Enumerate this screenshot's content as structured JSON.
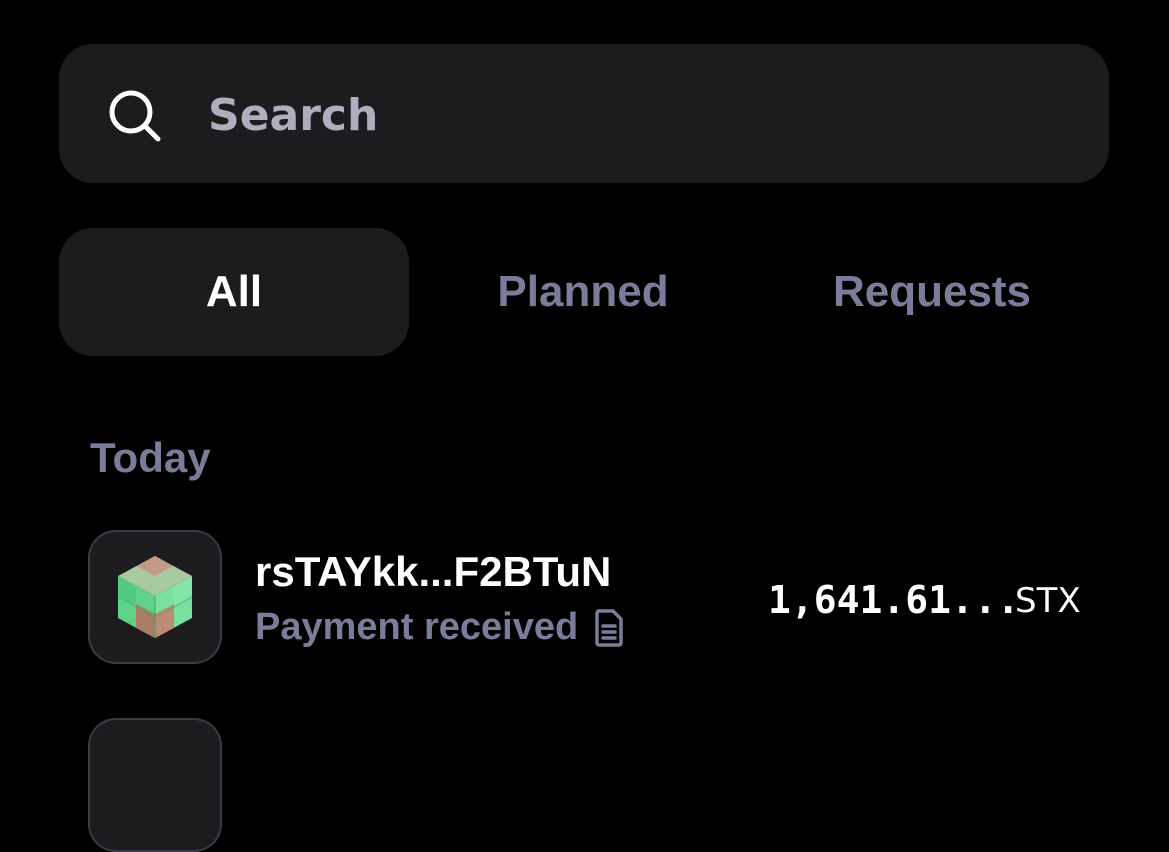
{
  "search": {
    "placeholder": "Search",
    "value": "",
    "icon": "search-icon"
  },
  "tabs": [
    {
      "label": "All",
      "active": true
    },
    {
      "label": "Planned",
      "active": false
    },
    {
      "label": "Requests",
      "active": false
    }
  ],
  "sections": [
    {
      "header": "Today",
      "transactions": [
        {
          "avatar": "cube-token-icon",
          "address": "rsTAYkk...F2BTuN",
          "status": "Payment received",
          "memo_icon": "document-icon",
          "amount": "1,641.61...",
          "currency": "STX"
        }
      ]
    }
  ],
  "colors": {
    "background": "#000000",
    "surface": "#1c1c1f",
    "muted_text": "#7a7d99",
    "placeholder_text": "#aeaebd",
    "primary_text": "#ffffff"
  }
}
